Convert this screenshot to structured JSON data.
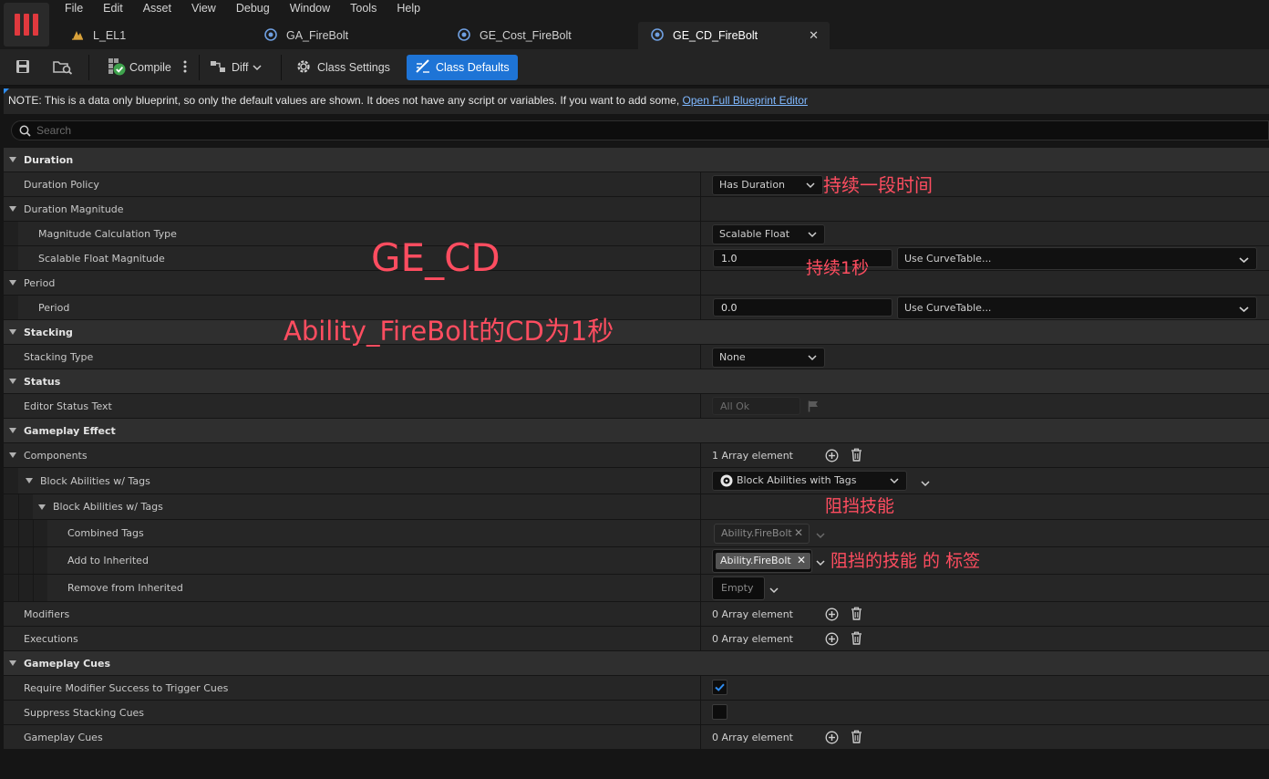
{
  "menu": [
    "File",
    "Edit",
    "Asset",
    "View",
    "Debug",
    "Window",
    "Tools",
    "Help"
  ],
  "tabs": [
    {
      "label": "L_EL1",
      "icon": "level-icon"
    },
    {
      "label": "GA_FireBolt",
      "icon": "blueprint-icon"
    },
    {
      "label": "GE_Cost_FireBolt",
      "icon": "blueprint-icon"
    },
    {
      "label": "GE_CD_FireBolt",
      "icon": "blueprint-icon",
      "active": true
    }
  ],
  "toolbar": {
    "compile": "Compile",
    "diff": "Diff",
    "class_settings": "Class Settings",
    "class_defaults": "Class Defaults"
  },
  "note": {
    "text": "NOTE: This is a data only blueprint, so only the default values are shown.  It does not have any script or variables.  If you want to add some, ",
    "link": "Open Full Blueprint Editor"
  },
  "search": {
    "placeholder": "Search"
  },
  "rows": {
    "duration": "Duration",
    "duration_policy": "Duration Policy",
    "duration_policy_value": "Has Duration",
    "duration_magnitude": "Duration Magnitude",
    "magnitude_calc_type": "Magnitude Calculation Type",
    "magnitude_calc_value": "Scalable Float",
    "scalable_float_magnitude": "Scalable Float Magnitude",
    "scalable_float_value": "1.0",
    "curve_table": "Use CurveTable...",
    "period_cat": "Period",
    "period": "Period",
    "period_value": "0.0",
    "stacking": "Stacking",
    "stacking_type": "Stacking Type",
    "stacking_type_value": "None",
    "status": "Status",
    "editor_status_text": "Editor Status Text",
    "editor_status_value": "All Ok",
    "gameplay_effect": "Gameplay Effect",
    "components": "Components",
    "components_value": "1 Array element",
    "block_abilities": "Block Abilities w/ Tags",
    "block_abilities_value": "Block Abilities with Tags",
    "block_abilities_inner": "Block Abilities w/ Tags",
    "combined_tags": "Combined Tags",
    "combined_tag_value": "Ability.FireBolt",
    "add_to_inherited": "Add to Inherited",
    "add_tag_value": "Ability.FireBolt",
    "remove_from_inherited": "Remove from Inherited",
    "remove_value": "Empty",
    "modifiers": "Modifiers",
    "modifiers_value": "0 Array element",
    "executions": "Executions",
    "executions_value": "0 Array element",
    "gameplay_cues_cat": "Gameplay Cues",
    "require_modifier_success": "Require Modifier Success to Trigger Cues",
    "require_modifier_success_checked": true,
    "suppress_stacking_cues": "Suppress Stacking Cues",
    "suppress_stacking_cues_checked": false,
    "gameplay_cues": "Gameplay Cues",
    "gameplay_cues_value": "0 Array element"
  },
  "annotations": {
    "duration_note": "持续一段时间",
    "title": "GE_CD",
    "one_second": "持续1秒",
    "subtitle": "Ability_FireBolt的CD为1秒",
    "block_note": "阻挡技能",
    "tag_note": "阻挡的技能 的 标签"
  },
  "colors": {
    "accent": "#1e74d6",
    "annotation": "#ff4d60",
    "logo": "#e0393e",
    "link": "#7fb8ff"
  }
}
